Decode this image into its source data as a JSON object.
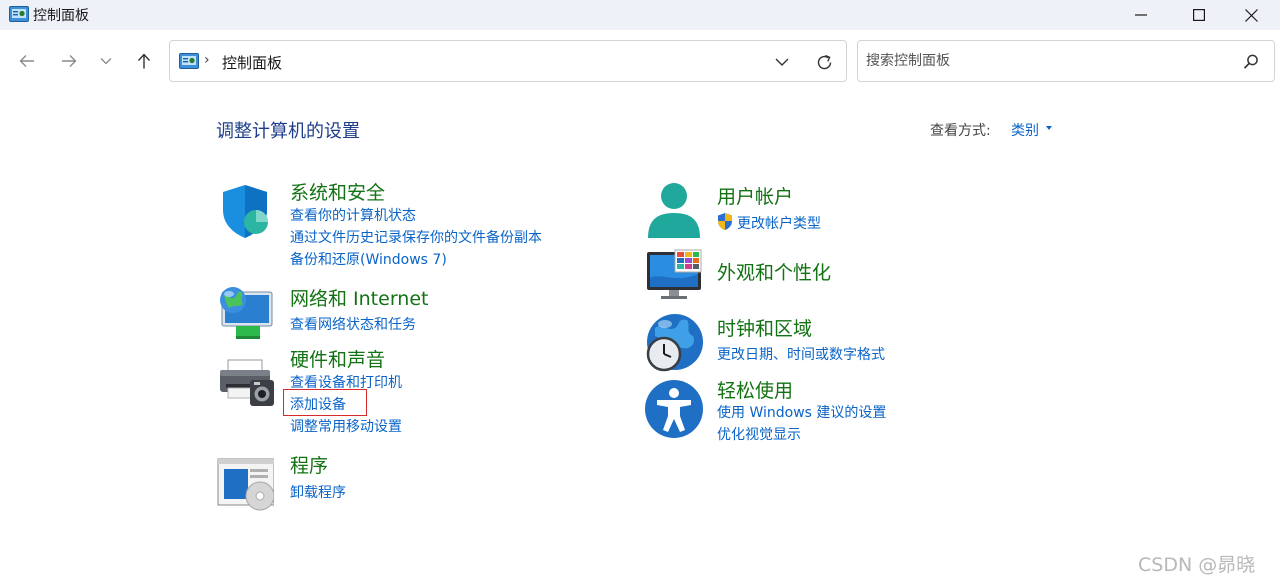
{
  "window": {
    "title": "控制面板"
  },
  "nav": {
    "address": "控制面板",
    "address_separator": "›",
    "search_placeholder": "搜索控制面板"
  },
  "header": {
    "title": "调整计算机的设置",
    "view_label": "查看方式:",
    "view_value": "类别"
  },
  "left_categories": [
    {
      "title": "系统和安全",
      "icon": "shield-icon",
      "links": [
        "查看你的计算机状态",
        "通过文件历史记录保存你的文件备份副本",
        "备份和还原(Windows 7)"
      ]
    },
    {
      "title": "网络和 Internet",
      "icon": "network-globe-icon",
      "links": [
        "查看网络状态和任务"
      ]
    },
    {
      "title": "硬件和声音",
      "icon": "printer-icon",
      "links": [
        "查看设备和打印机",
        "添加设备",
        "调整常用移动设置"
      ]
    },
    {
      "title": "程序",
      "icon": "programs-icon",
      "links": [
        "卸载程序"
      ]
    }
  ],
  "right_categories": [
    {
      "title": "用户帐户",
      "icon": "user-icon",
      "links": [
        "更改帐户类型"
      ]
    },
    {
      "title": "外观和个性化",
      "icon": "monitor-icon",
      "links": []
    },
    {
      "title": "时钟和区域",
      "icon": "clock-globe-icon",
      "links": [
        "更改日期、时间或数字格式"
      ]
    },
    {
      "title": "轻松使用",
      "icon": "accessibility-icon",
      "links": [
        "使用 Windows 建议的设置",
        "优化视觉显示"
      ]
    }
  ],
  "watermark": "CSDN @昴晓",
  "colors": {
    "category_title": "#137213",
    "link": "#0a64c8",
    "page_title": "#1e3e8c",
    "highlight": "#d82a2a"
  }
}
